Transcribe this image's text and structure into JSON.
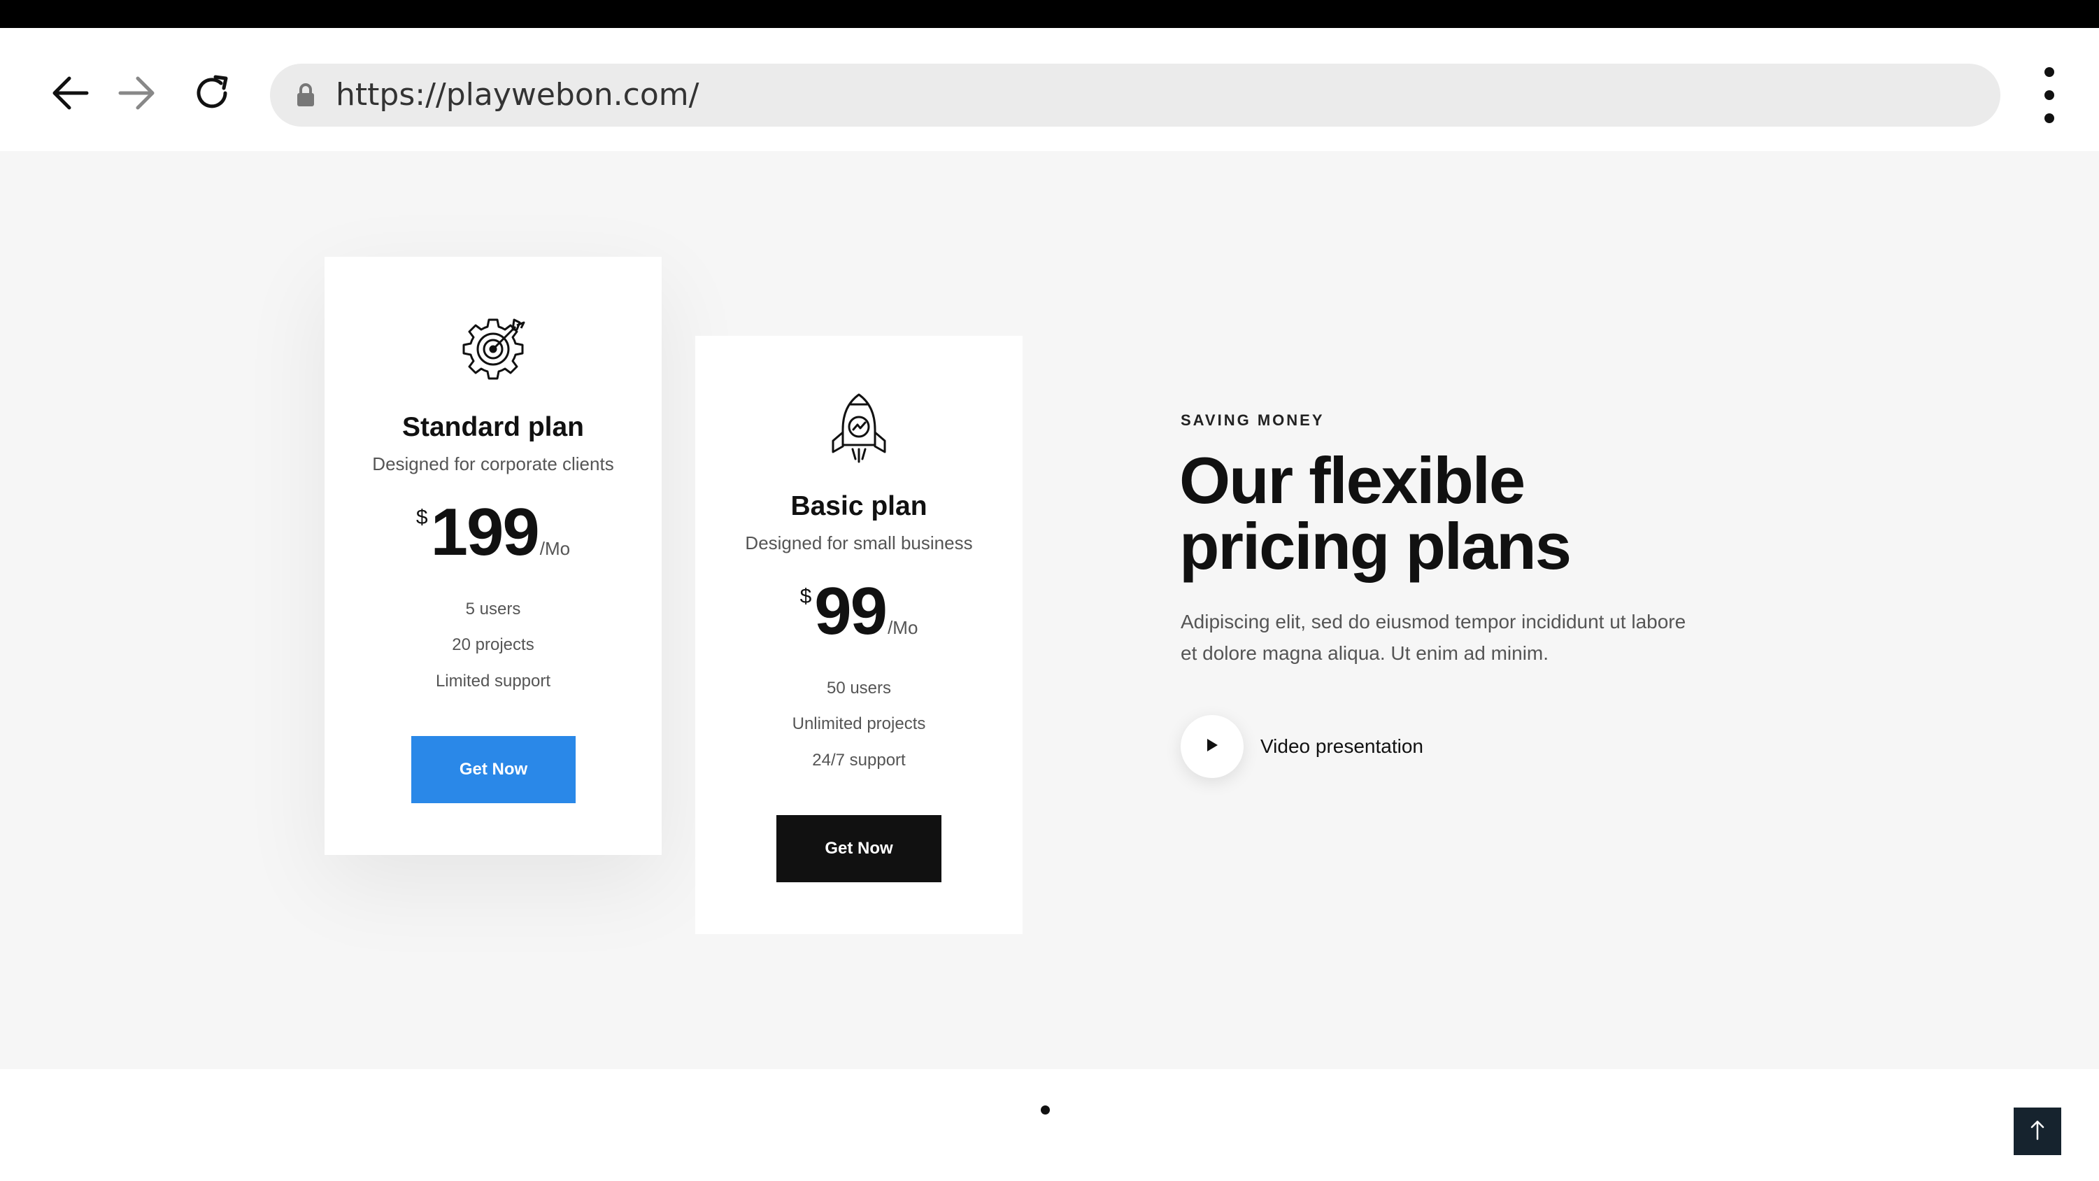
{
  "browser": {
    "url": "https://playwebon.com/",
    "icons": {
      "back": "arrow-left-icon",
      "forward": "arrow-right-icon",
      "reload": "reload-icon",
      "lock": "lock-icon",
      "menu": "kebab-menu-icon"
    }
  },
  "pricing": {
    "plans": [
      {
        "icon": "gear-target-icon",
        "name": "Standard plan",
        "description": "Designed for corporate clients",
        "currency": "$",
        "amount": "199",
        "period": "/Mo",
        "features": [
          "5 users",
          "20 projects",
          "Limited support"
        ],
        "button_label": "Get Now",
        "button_color": "#2a88e8"
      },
      {
        "icon": "rocket-icon",
        "name": "Basic plan",
        "description": "Designed for small business",
        "currency": "$",
        "amount": "99",
        "period": "/Mo",
        "features": [
          "50 users",
          "Unlimited projects",
          "24/7 support"
        ],
        "button_label": "Get Now",
        "button_color": "#111111"
      }
    ]
  },
  "hero": {
    "eyebrow": "SAVING MONEY",
    "headline_line1": "Our flexible",
    "headline_line2": "pricing plans",
    "paragraph_line1": "Adipiscing elit, sed do eiusmod tempor incididunt ut labore",
    "paragraph_line2": "et dolore magna aliqua. Ut enim ad minim.",
    "video_label": "Video presentation",
    "video_icon": "play-icon"
  },
  "slider": {
    "active_index": 0
  },
  "scroll_top_icon": "arrow-up-icon",
  "colors": {
    "accent_blue": "#2a88e8",
    "dark": "#111111",
    "section_bg": "#f6f6f6",
    "scroll_top_bg": "#16232e"
  }
}
